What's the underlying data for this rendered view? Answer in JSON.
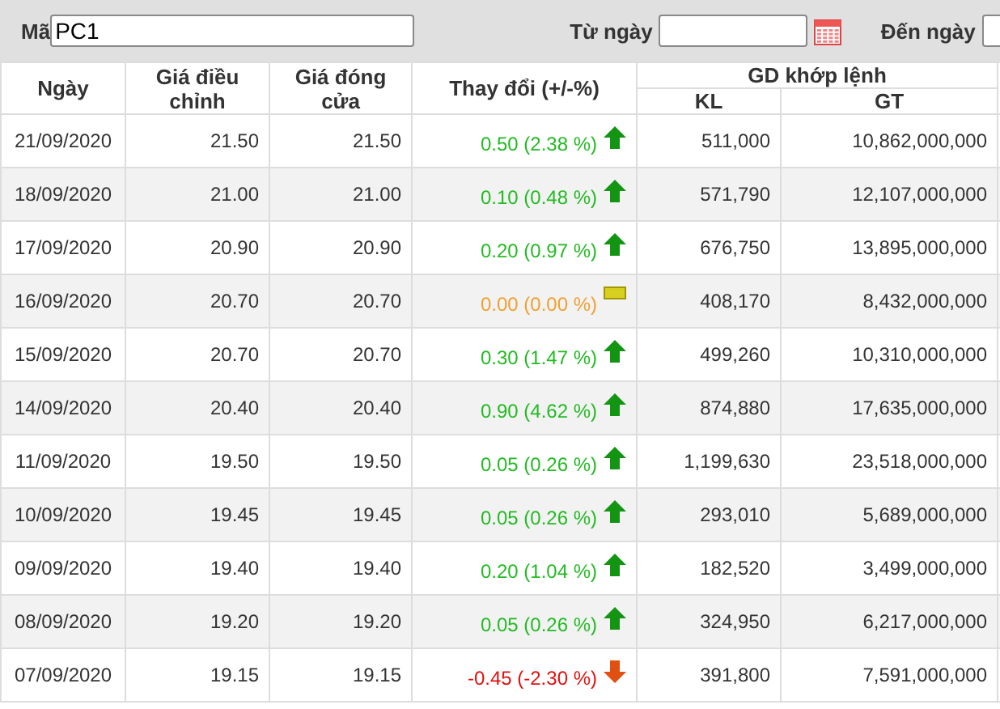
{
  "filter": {
    "code_label": "Mã",
    "code_value": "PC1",
    "from_label": "Từ ngày",
    "to_label": "Đến ngày"
  },
  "table": {
    "columns": [
      "Ngày",
      "Giá điều chỉnh",
      "Giá đóng cửa",
      "Thay đổi (+/-%)"
    ],
    "group_header": "GD khớp lệnh",
    "subcolumns": [
      "KL",
      "GT"
    ],
    "rows": [
      {
        "date": "21/09/2020",
        "adjusted": "21.50",
        "close": "21.50",
        "change": "0.50 (2.38 %)",
        "kind": "up",
        "volume": "511,000",
        "value": "10,862,000,000"
      },
      {
        "date": "18/09/2020",
        "adjusted": "21.00",
        "close": "21.00",
        "change": "0.10 (0.48 %)",
        "kind": "up",
        "volume": "571,790",
        "value": "12,107,000,000"
      },
      {
        "date": "17/09/2020",
        "adjusted": "20.90",
        "close": "20.90",
        "change": "0.20 (0.97 %)",
        "kind": "up",
        "volume": "676,750",
        "value": "13,895,000,000"
      },
      {
        "date": "16/09/2020",
        "adjusted": "20.70",
        "close": "20.70",
        "change": "0.00 (0.00 %)",
        "kind": "flat",
        "volume": "408,170",
        "value": "8,432,000,000"
      },
      {
        "date": "15/09/2020",
        "adjusted": "20.70",
        "close": "20.70",
        "change": "0.30 (1.47 %)",
        "kind": "up",
        "volume": "499,260",
        "value": "10,310,000,000"
      },
      {
        "date": "14/09/2020",
        "adjusted": "20.40",
        "close": "20.40",
        "change": "0.90 (4.62 %)",
        "kind": "up",
        "volume": "874,880",
        "value": "17,635,000,000"
      },
      {
        "date": "11/09/2020",
        "adjusted": "19.50",
        "close": "19.50",
        "change": "0.05 (0.26 %)",
        "kind": "up",
        "volume": "1,199,630",
        "value": "23,518,000,000"
      },
      {
        "date": "10/09/2020",
        "adjusted": "19.45",
        "close": "19.45",
        "change": "0.05 (0.26 %)",
        "kind": "up",
        "volume": "293,010",
        "value": "5,689,000,000"
      },
      {
        "date": "09/09/2020",
        "adjusted": "19.40",
        "close": "19.40",
        "change": "0.20 (1.04 %)",
        "kind": "up",
        "volume": "182,520",
        "value": "3,499,000,000"
      },
      {
        "date": "08/09/2020",
        "adjusted": "19.20",
        "close": "19.20",
        "change": "0.05 (0.26 %)",
        "kind": "up",
        "volume": "324,950",
        "value": "6,217,000,000"
      },
      {
        "date": "07/09/2020",
        "adjusted": "19.15",
        "close": "19.15",
        "change": "-0.45 (-2.30 %)",
        "kind": "down",
        "volume": "391,800",
        "value": "7,591,000,000"
      }
    ]
  }
}
